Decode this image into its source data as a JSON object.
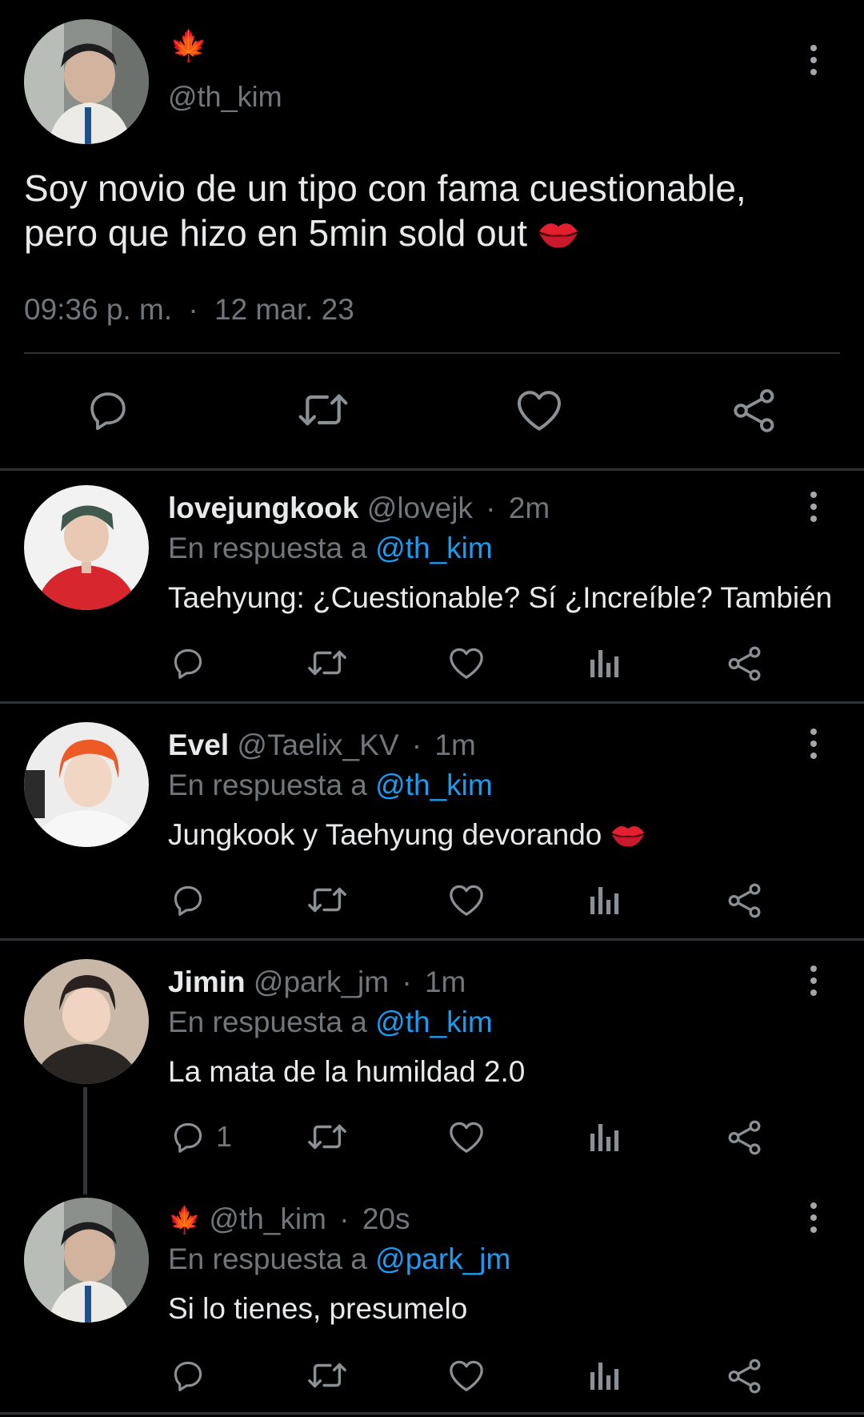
{
  "main": {
    "maple_emoji": "🍁",
    "handle": "@th_kim",
    "text_line1": "Soy novio de un tipo con fama cuestionable,",
    "text_line2": "pero que hizo en 5min sold out",
    "time": "09:36 p. m.",
    "sep": "·",
    "date": "12 mar. 23"
  },
  "replies": [
    {
      "name": "lovejungkook",
      "handle": "@lovejk",
      "time": "2m",
      "reply_prefix": "En respuesta a",
      "reply_to": "@th_kim",
      "text": "Taehyung: ¿Cuestionable? Sí ¿Increíble? También",
      "reply_count": ""
    },
    {
      "name": "Evel",
      "handle": "@Taelix_KV",
      "time": "1m",
      "reply_prefix": "En respuesta a",
      "reply_to": "@th_kim",
      "text": "Jungkook y Taehyung devorando",
      "reply_count": ""
    },
    {
      "name": "Jimin",
      "handle": "@park_jm",
      "time": "1m",
      "reply_prefix": "En respuesta a",
      "reply_to": "@th_kim",
      "text": "La mata de la humildad 2.0",
      "reply_count": "1"
    },
    {
      "name": "🍁",
      "handle": "@th_kim",
      "time": "20s",
      "reply_prefix": "En respuesta a",
      "reply_to": "@park_jm",
      "text": "Si lo tienes, presumelo",
      "reply_count": ""
    }
  ],
  "colors": {
    "background": "#000000",
    "text": "#e7e9ea",
    "muted": "#71767b",
    "link": "#1d9bf0",
    "divider": "#2f3336"
  },
  "icons": [
    "maple-leaf-icon",
    "more-icon",
    "reply-icon",
    "retweet-icon",
    "like-icon",
    "views-icon",
    "share-icon",
    "kiss-icon"
  ]
}
